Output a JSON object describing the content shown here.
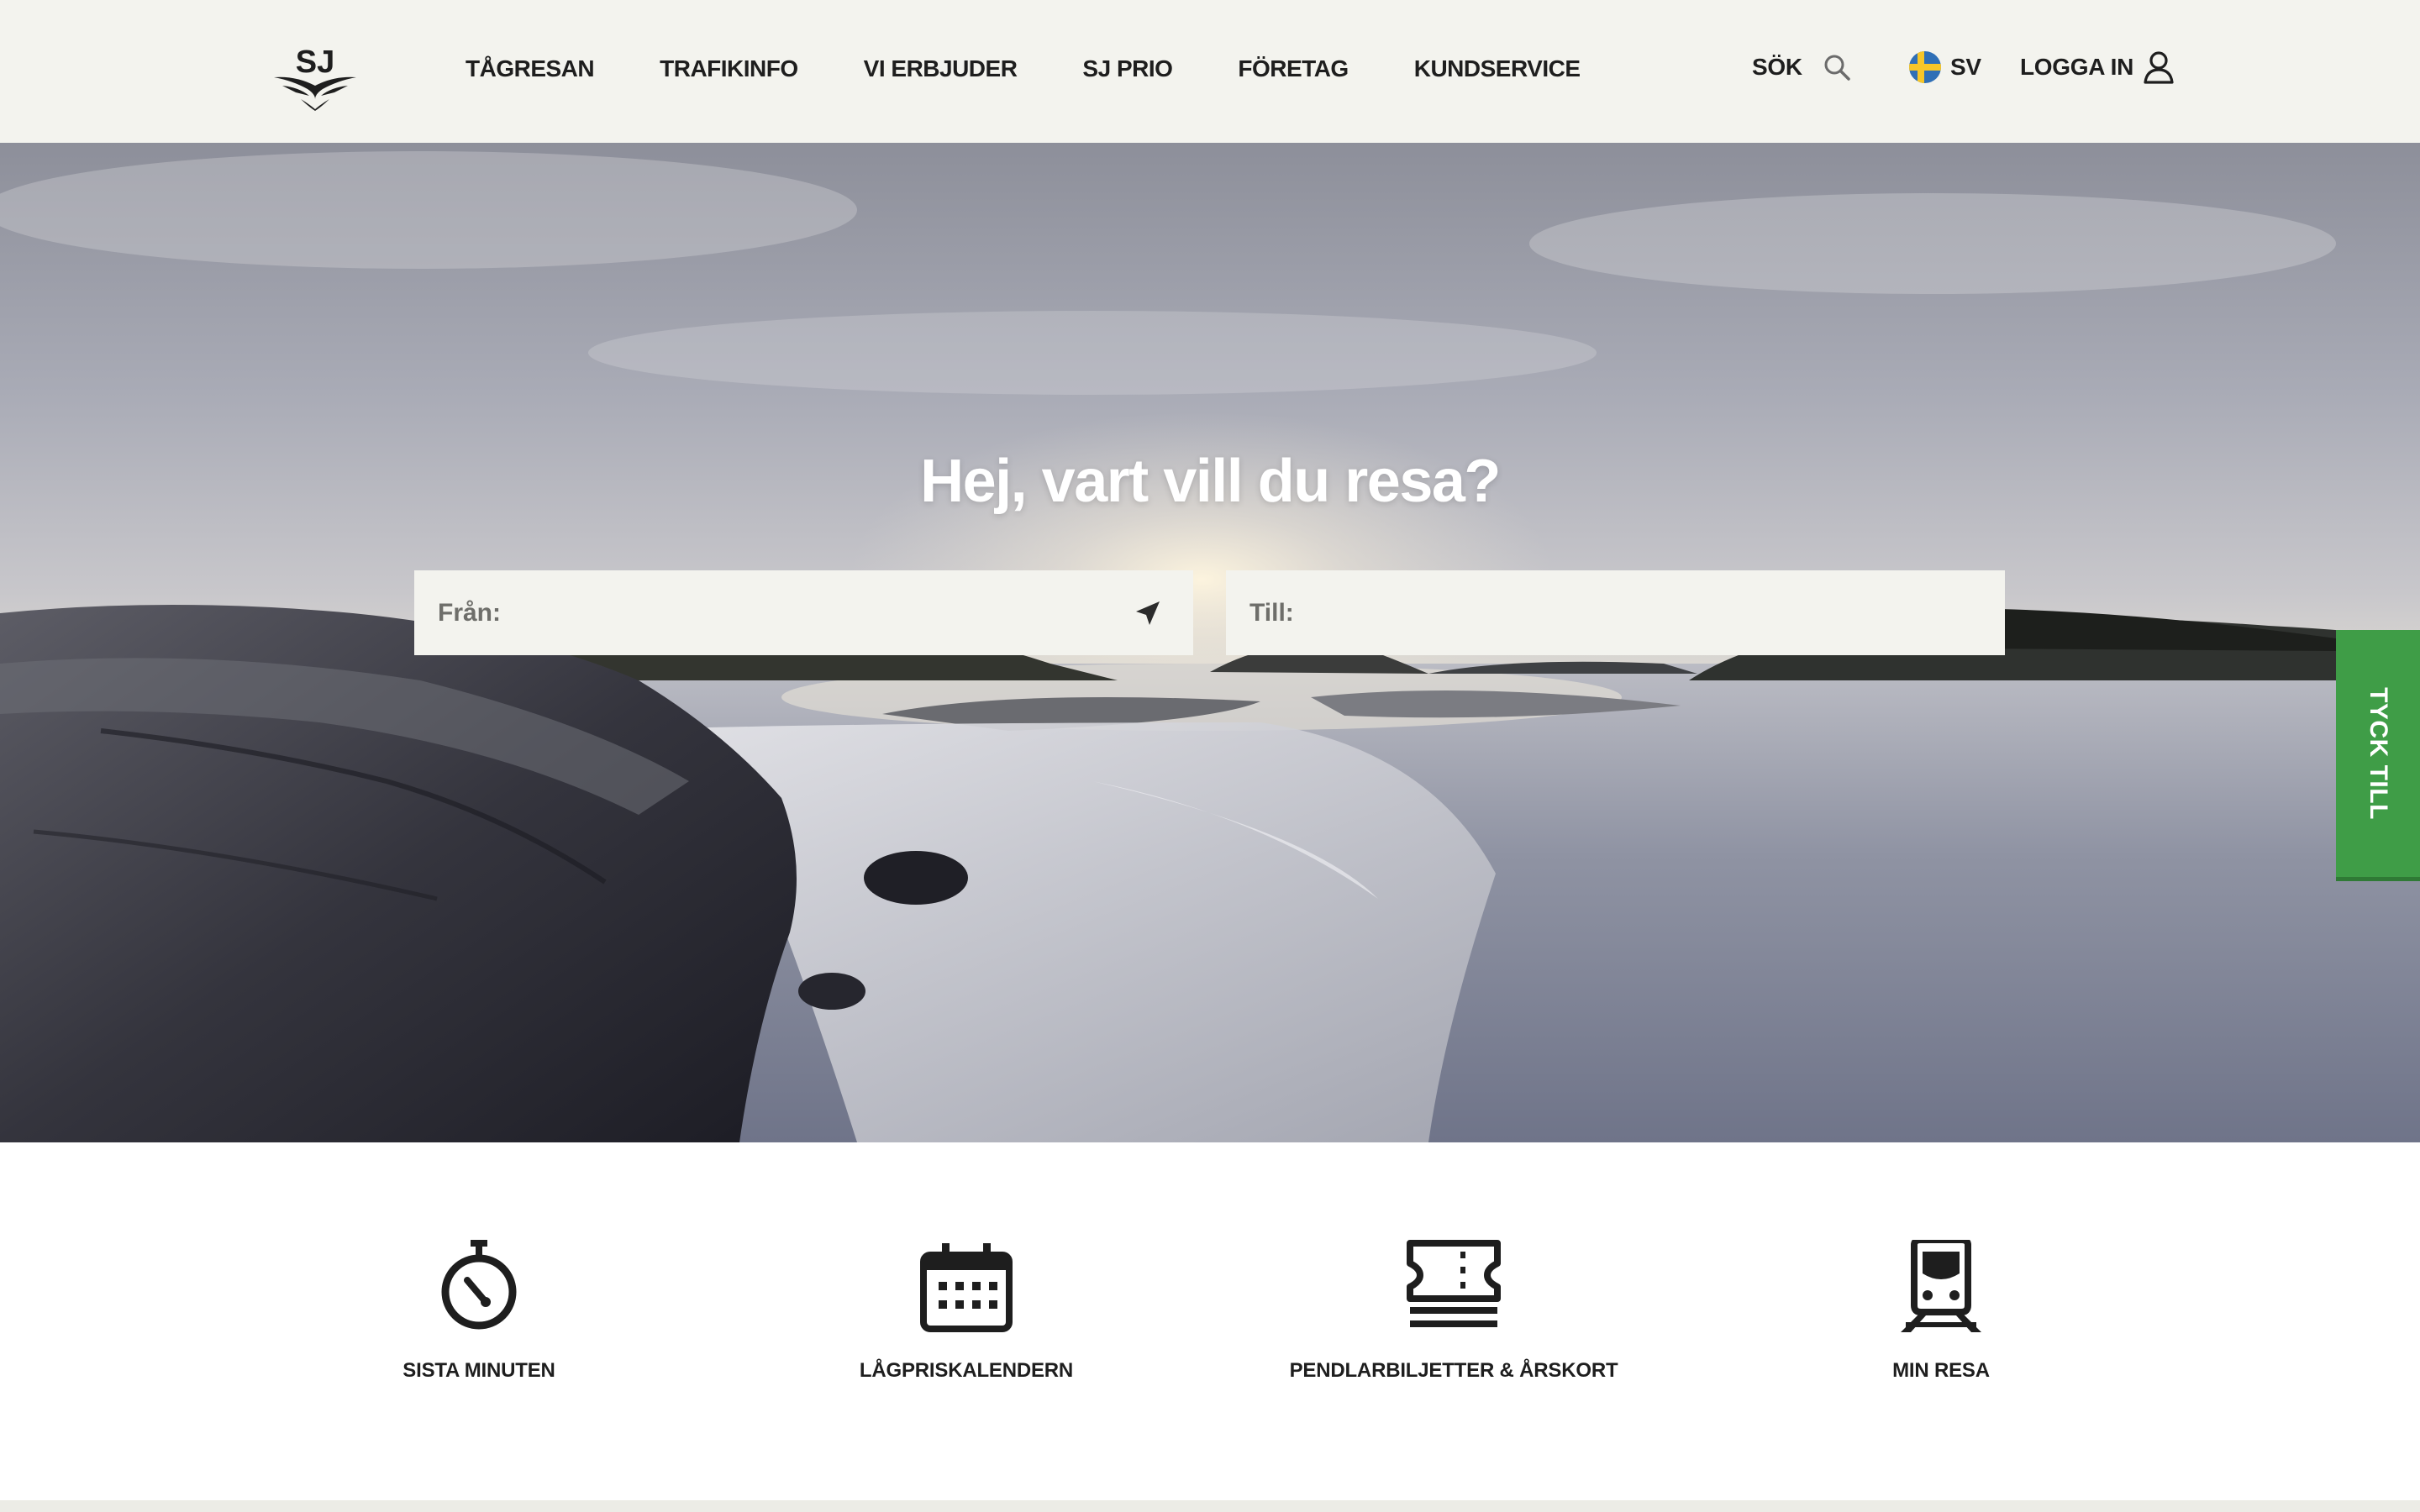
{
  "header": {
    "logo_text": "SJ",
    "nav": [
      "TÅGRESAN",
      "TRAFIKINFO",
      "VI ERBJUDER",
      "SJ PRIO",
      "FÖRETAG",
      "KUNDSERVICE"
    ],
    "search_label": "SÖK",
    "language_label": "SV",
    "login_label": "LOGGA IN"
  },
  "hero": {
    "title": "Hej, vart vill du resa?",
    "from_label": "Från:",
    "from_value": "",
    "to_label": "Till:",
    "to_value": ""
  },
  "feedback_tab": {
    "label": "TYCK TILL"
  },
  "quick_links": [
    {
      "label": "SISTA MINUTEN",
      "icon": "stopwatch-icon"
    },
    {
      "label": "LÅGPRISKALENDERN",
      "icon": "calendar-icon"
    },
    {
      "label": "PENDLARBILJETTER & ÅRSKORT",
      "icon": "tickets-icon"
    },
    {
      "label": "MIN RESA",
      "icon": "train-icon"
    }
  ],
  "colors": {
    "header_bg": "#f3f3ee",
    "text": "#1e1e1e",
    "feedback_green": "#3f9d47",
    "field_bg": "#f3f3ee"
  }
}
